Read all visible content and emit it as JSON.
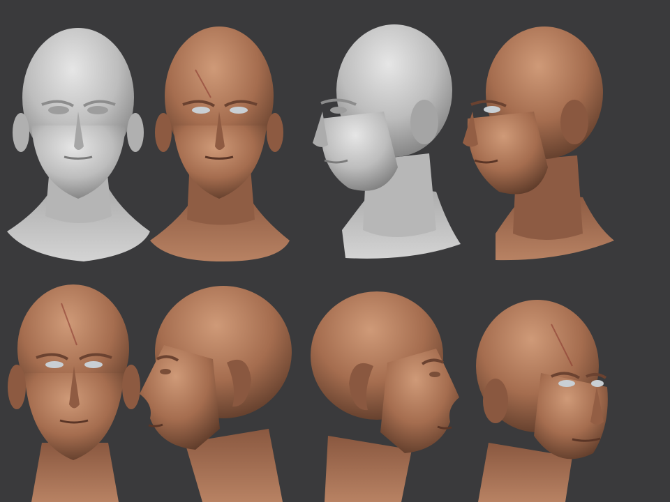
{
  "scene": {
    "background_color": "#3a3a3c",
    "clay_color": "#c4c4c4",
    "skin_color": "#b07a5c",
    "renders": [
      {
        "row": 1,
        "view": "front",
        "material": "clay"
      },
      {
        "row": 1,
        "view": "front",
        "material": "skin"
      },
      {
        "row": 1,
        "view": "three-quarter",
        "material": "clay"
      },
      {
        "row": 1,
        "view": "three-quarter",
        "material": "skin"
      },
      {
        "row": 2,
        "view": "front",
        "material": "skin"
      },
      {
        "row": 2,
        "view": "side-left",
        "material": "skin"
      },
      {
        "row": 2,
        "view": "side-right",
        "material": "skin"
      },
      {
        "row": 2,
        "view": "three-quarter",
        "material": "skin"
      }
    ]
  }
}
